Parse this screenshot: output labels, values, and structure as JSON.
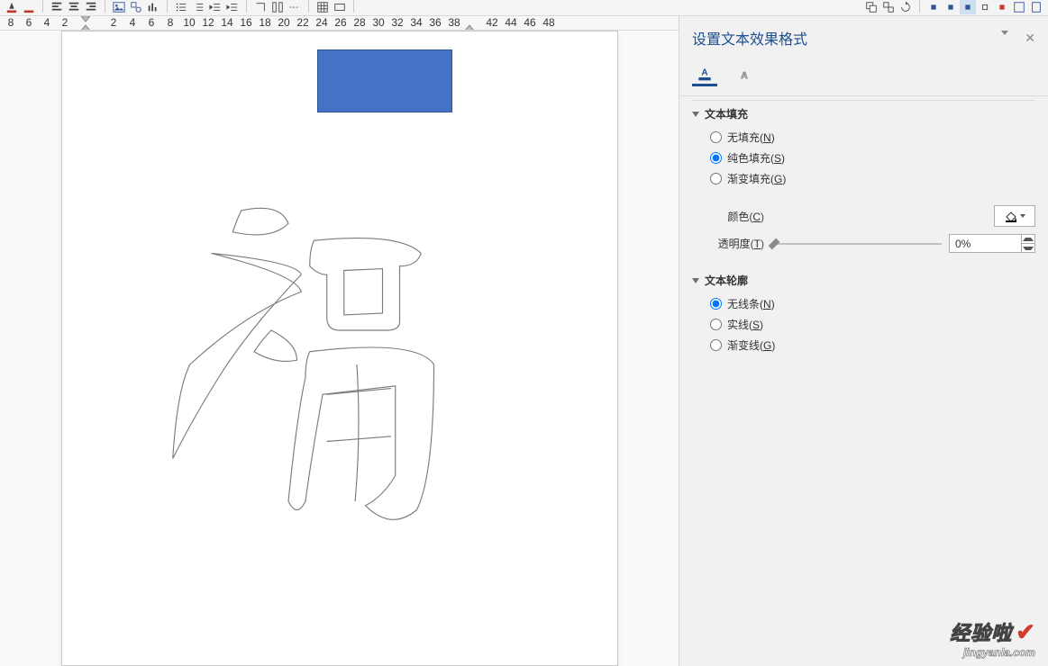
{
  "panel": {
    "title": "设置文本效果格式",
    "sections": {
      "fill": {
        "title": "文本填充",
        "options": {
          "none": {
            "label": "无填充",
            "key": "N"
          },
          "solid": {
            "label": "纯色填充",
            "key": "S"
          },
          "grad": {
            "label": "渐变填充",
            "key": "G"
          }
        },
        "colorLabel": "颜色",
        "colorKey": "C",
        "transLabel": "透明度",
        "transKey": "T",
        "transValue": "0%"
      },
      "outline": {
        "title": "文本轮廓",
        "options": {
          "none": {
            "label": "无线条",
            "key": "N"
          },
          "solid": {
            "label": "实线",
            "key": "S"
          },
          "grad": {
            "label": "渐变线",
            "key": "G"
          }
        }
      }
    }
  },
  "ruler": {
    "left": [
      "8",
      "6",
      "4",
      "2"
    ],
    "right": [
      "2",
      "4",
      "6",
      "8",
      "10",
      "12",
      "14",
      "16",
      "18",
      "20",
      "22",
      "24",
      "26",
      "28",
      "30",
      "32",
      "34",
      "36",
      "38",
      "42",
      "44",
      "46",
      "48"
    ]
  },
  "document": {
    "char": "福"
  },
  "watermark": {
    "line1": "经验啦",
    "line2": "jingyanla.com"
  }
}
